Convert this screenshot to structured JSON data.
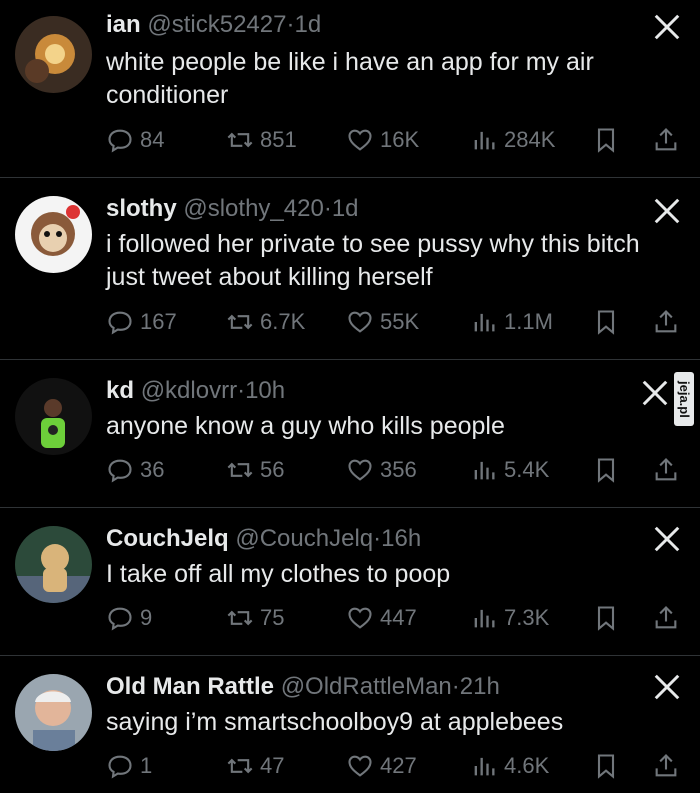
{
  "tweets": [
    {
      "name": "ian",
      "handle": "@stick52427",
      "dot": "·",
      "time": "1d",
      "text": "white people be like i have an app for my air conditioner",
      "replies": "84",
      "reposts": "851",
      "likes": "16K",
      "views": "284K"
    },
    {
      "name": "slothy",
      "handle": "@slothy_420",
      "dot": "·",
      "time": "1d",
      "text": "i followed her private to see pussy why this bitch just tweet about killing herself",
      "replies": "167",
      "reposts": "6.7K",
      "likes": "55K",
      "views": "1.1M"
    },
    {
      "name": "kd",
      "handle": "@kdlovrr",
      "dot": "·",
      "time": "10h",
      "text": "anyone know a guy who kills people",
      "replies": "36",
      "reposts": "56",
      "likes": "356",
      "views": "5.4K"
    },
    {
      "name": "CouchJelq",
      "handle": "@CouchJelq",
      "dot": "·",
      "time": "16h",
      "text": "I take off all my clothes to poop",
      "replies": "9",
      "reposts": "75",
      "likes": "447",
      "views": "7.3K"
    },
    {
      "name": "Old Man Rattle",
      "handle": "@OldRattleMan",
      "dot": "·",
      "time": "21h",
      "text": "saying i’m smartschoolboy9 at applebees",
      "replies": "1",
      "reposts": "47",
      "likes": "427",
      "views": "4.6K"
    }
  ],
  "watermark": "jeja.pl",
  "icons": [
    "x-logo-icon",
    "reply-icon",
    "repost-icon",
    "like-icon",
    "views-icon",
    "bookmark-icon",
    "share-icon"
  ],
  "colors": {
    "background": "#000000",
    "text": "#e7e9ea",
    "muted": "#71767b",
    "divider": "#2f3336"
  }
}
